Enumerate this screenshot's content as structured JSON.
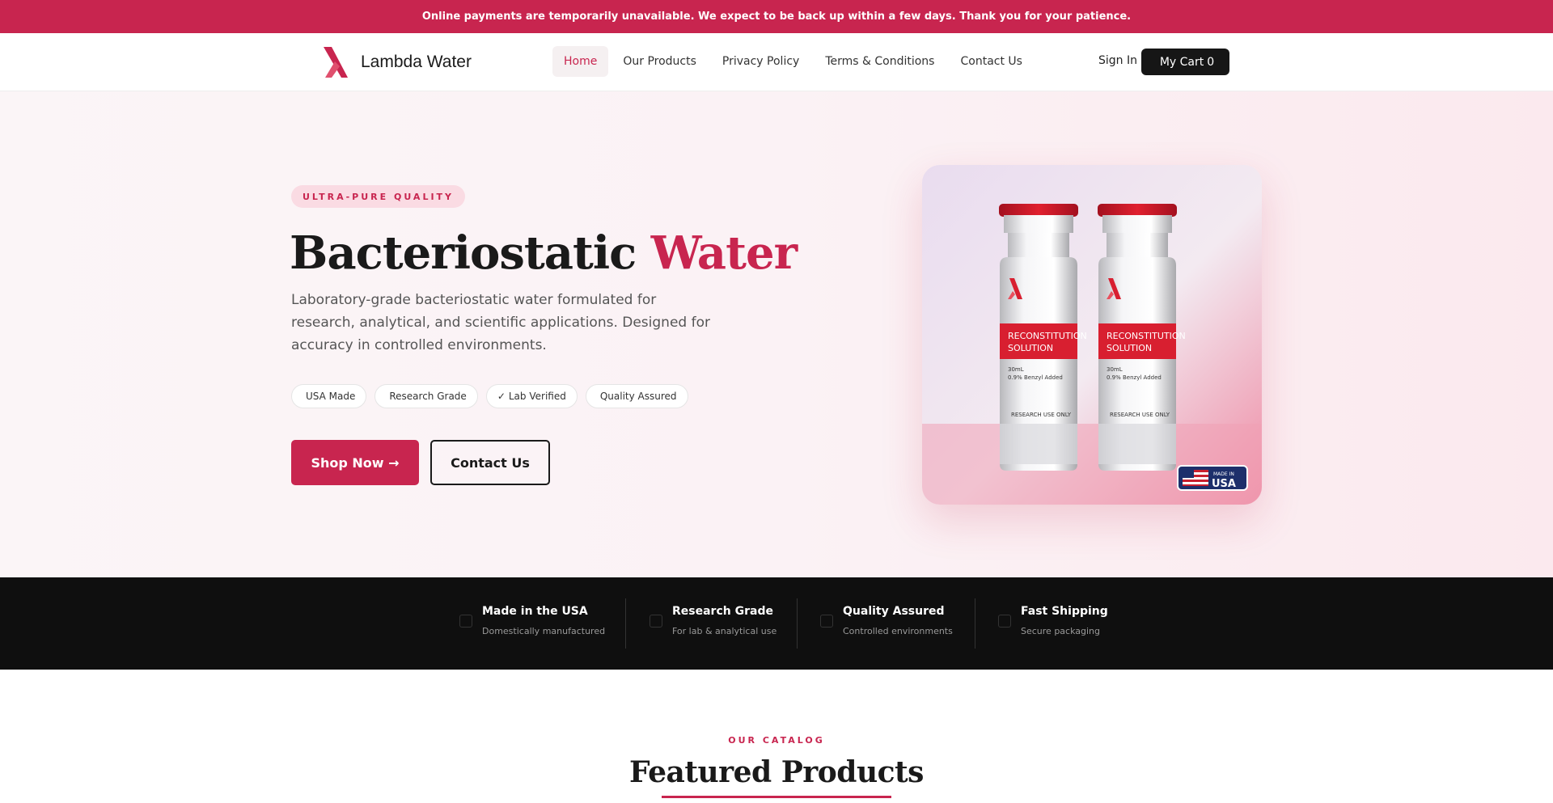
{
  "banner": {
    "text": "Online payments are temporarily unavailable. We expect to be back up within a few days. Thank you for your patience."
  },
  "brand": {
    "name": "Lambda Water",
    "accent_color": "#c8254f"
  },
  "nav": {
    "items": [
      {
        "label": "Home",
        "active": true
      },
      {
        "label": "Our Products",
        "active": false
      },
      {
        "label": "Privacy Policy",
        "active": false
      },
      {
        "label": "Terms & Conditions",
        "active": false
      },
      {
        "label": "Contact Us",
        "active": false
      }
    ],
    "sign_in": "Sign In",
    "cart": {
      "icon": "",
      "label": "My Cart",
      "count": "0"
    }
  },
  "hero": {
    "badge": "ULTRA-PURE QUALITY",
    "title_main": "Bacteriostatic",
    "title_accent": "Water",
    "description": "Laboratory-grade bacteriostatic water formulated for research, analytical, and scientific applications. Designed for accuracy in controlled environments.",
    "chips": [
      {
        "icon": "",
        "label": "USA Made"
      },
      {
        "icon": "",
        "label": "Research Grade"
      },
      {
        "icon": "✓",
        "label": "Lab Verified"
      },
      {
        "icon": "",
        "label": "Quality Assured"
      }
    ],
    "shop_button": "Shop Now →",
    "contact_button": "Contact Us",
    "vial_label_line1": "RECONSTITUTION",
    "vial_label_line2": "SOLUTION",
    "vial_volume": "30mL",
    "vial_additive": "0.9% Benzyl Added",
    "vial_footer": "RESEARCH USE ONLY",
    "made_in": "MADE IN",
    "usa": "USA"
  },
  "features": [
    {
      "title": "Made in the USA",
      "subtitle": "Domestically manufactured"
    },
    {
      "title": "Research Grade",
      "subtitle": "For lab & analytical use"
    },
    {
      "title": "Quality Assured",
      "subtitle": "Controlled environments"
    },
    {
      "title": "Fast Shipping",
      "subtitle": "Secure packaging"
    }
  ],
  "catalog": {
    "label": "OUR CATALOG",
    "title": "Featured Products"
  }
}
